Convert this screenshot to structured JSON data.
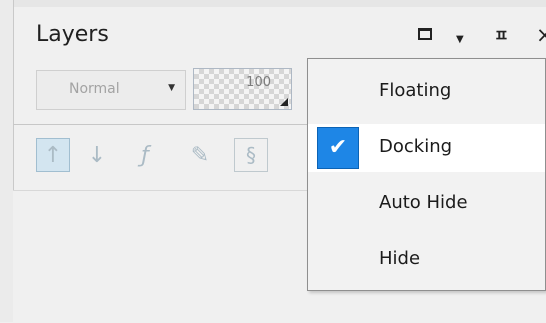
{
  "panel": {
    "title": "Layers",
    "controls": {
      "maximize_icon": "maximize-icon",
      "menu_icon": "dropdown-arrow-icon",
      "pin_icon": "pin-icon",
      "close_icon": "close-icon"
    }
  },
  "toolbar": {
    "blend_mode": "Normal",
    "opacity": "100"
  },
  "tool_icons": [
    "layer-up-icon",
    "layer-down-icon",
    "fx-icon",
    "edit-layer-icon",
    "script-icon"
  ],
  "context_menu": {
    "items": [
      {
        "label": "Floating",
        "checked": false
      },
      {
        "label": "Docking",
        "checked": true
      },
      {
        "label": "Auto Hide",
        "checked": false
      },
      {
        "label": "Hide",
        "checked": false
      }
    ]
  }
}
